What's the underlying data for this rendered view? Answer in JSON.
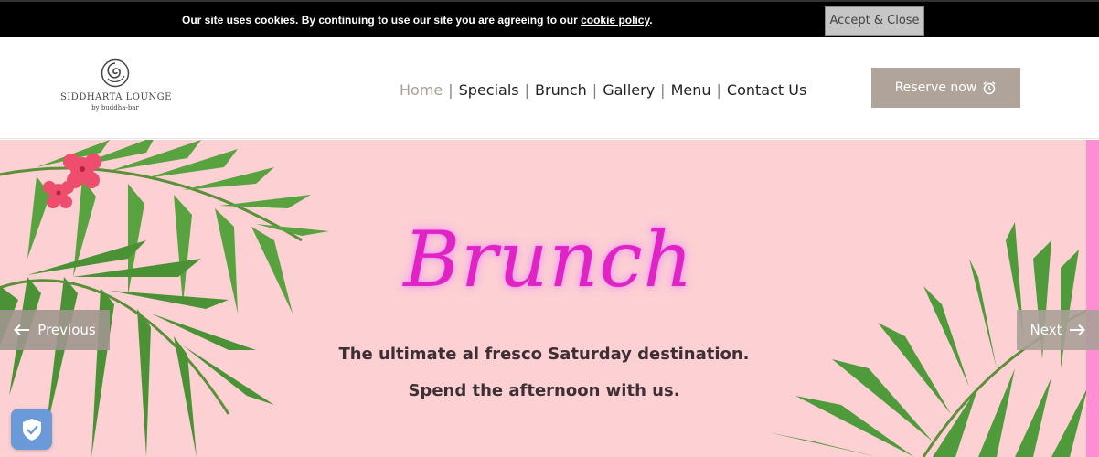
{
  "cookie": {
    "message": "Our site uses cookies. By continuing to use our site you are agreeing to our ",
    "link_text": "cookie policy",
    "suffix": ".",
    "accept_label": "Accept & Close"
  },
  "header": {
    "logo_name": "SIDDHARTA LOUNGE",
    "logo_sub": "by buddha-bar",
    "nav": [
      "Home",
      "Specials",
      "Brunch",
      "Gallery",
      "Menu",
      "Contact Us"
    ],
    "nav_separator": "|",
    "active_nav": "Home",
    "reserve_label": "Reserve now",
    "reserve_icon": "alarm-clock-icon"
  },
  "hero": {
    "title": "Brunch",
    "line1": "The ultimate al fresco Saturday destination.",
    "line2": "Spend the afternoon with us.",
    "prev_label": "Previous",
    "next_label": "Next",
    "background_color": "#fdd0d3",
    "title_color": "#e023c3"
  },
  "privacy_badge": {
    "icon": "shield-check-icon"
  },
  "colors": {
    "accent": "#b0a49a",
    "active_nav": "#a99e93",
    "scroll_strip": "#ff8fd2"
  }
}
